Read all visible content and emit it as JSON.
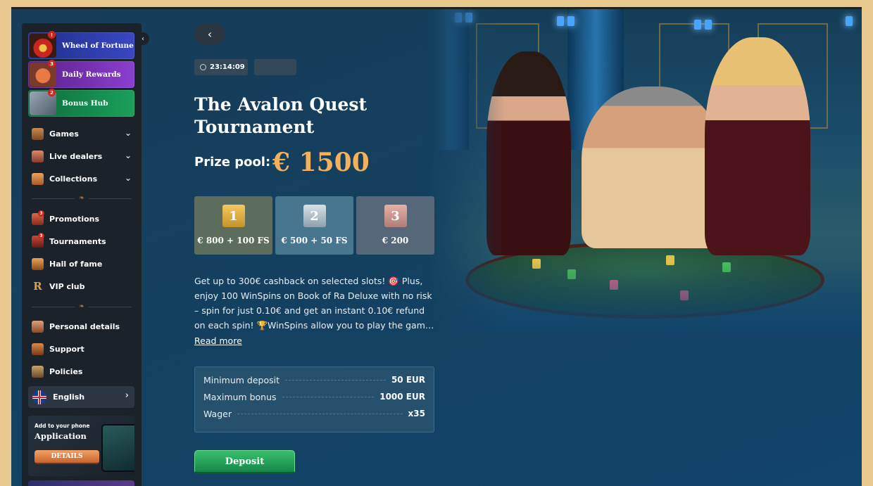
{
  "sidebar": {
    "featured": [
      {
        "label": "Wheel of Fortune",
        "badge": "!"
      },
      {
        "label": "Daily Rewards",
        "badge": "3"
      },
      {
        "label": "Bonus Hub",
        "badge": "2"
      }
    ],
    "menu": [
      {
        "label": "Games"
      },
      {
        "label": "Live dealers"
      },
      {
        "label": "Collections"
      },
      {
        "label": "Promotions",
        "badge": "3"
      },
      {
        "label": "Tournaments",
        "badge": "3"
      },
      {
        "label": "Hall of fame"
      },
      {
        "label": "VIP club"
      },
      {
        "label": "Personal details"
      },
      {
        "label": "Support"
      },
      {
        "label": "Policies"
      }
    ],
    "language": "English",
    "app_promo": {
      "small": "Add to your phone",
      "big": "Application",
      "button": "DETAILS"
    }
  },
  "tournament": {
    "timer": "23:14:09",
    "title": "The Avalon Quest Tournament",
    "prize_label": "Prize pool:",
    "prize_value": "€ 1500",
    "places": [
      {
        "num": "1",
        "prize": "€ 800 + 100 FS"
      },
      {
        "num": "2",
        "prize": "€ 500 + 50 FS"
      },
      {
        "num": "3",
        "prize": "€ 200"
      }
    ],
    "description": "Get up to 300€ cashback on selected slots! 🎯 Plus, enjoy 100 WinSpins on Book of Ra Deluxe with no risk – spin for just 0.10€ and get an instant 0.10€ refund on each spin! 🏆WinSpins allow you to play the game without risk",
    "read_more": "Read more",
    "info": [
      {
        "label": "Minimum deposit",
        "value": "50 EUR"
      },
      {
        "label": "Maximum bonus",
        "value": "1000 EUR"
      },
      {
        "label": "Wager",
        "value": "x35"
      }
    ],
    "deposit_button": "Deposit"
  },
  "icons": {
    "back": "chevron-left-icon",
    "collapse": "chevron-left-icon",
    "clock": "clock-icon"
  },
  "colors": {
    "prize_gold": "#f2b15a",
    "deposit_green": "#1aa05a",
    "sidebar_bg": "#1c2229"
  }
}
